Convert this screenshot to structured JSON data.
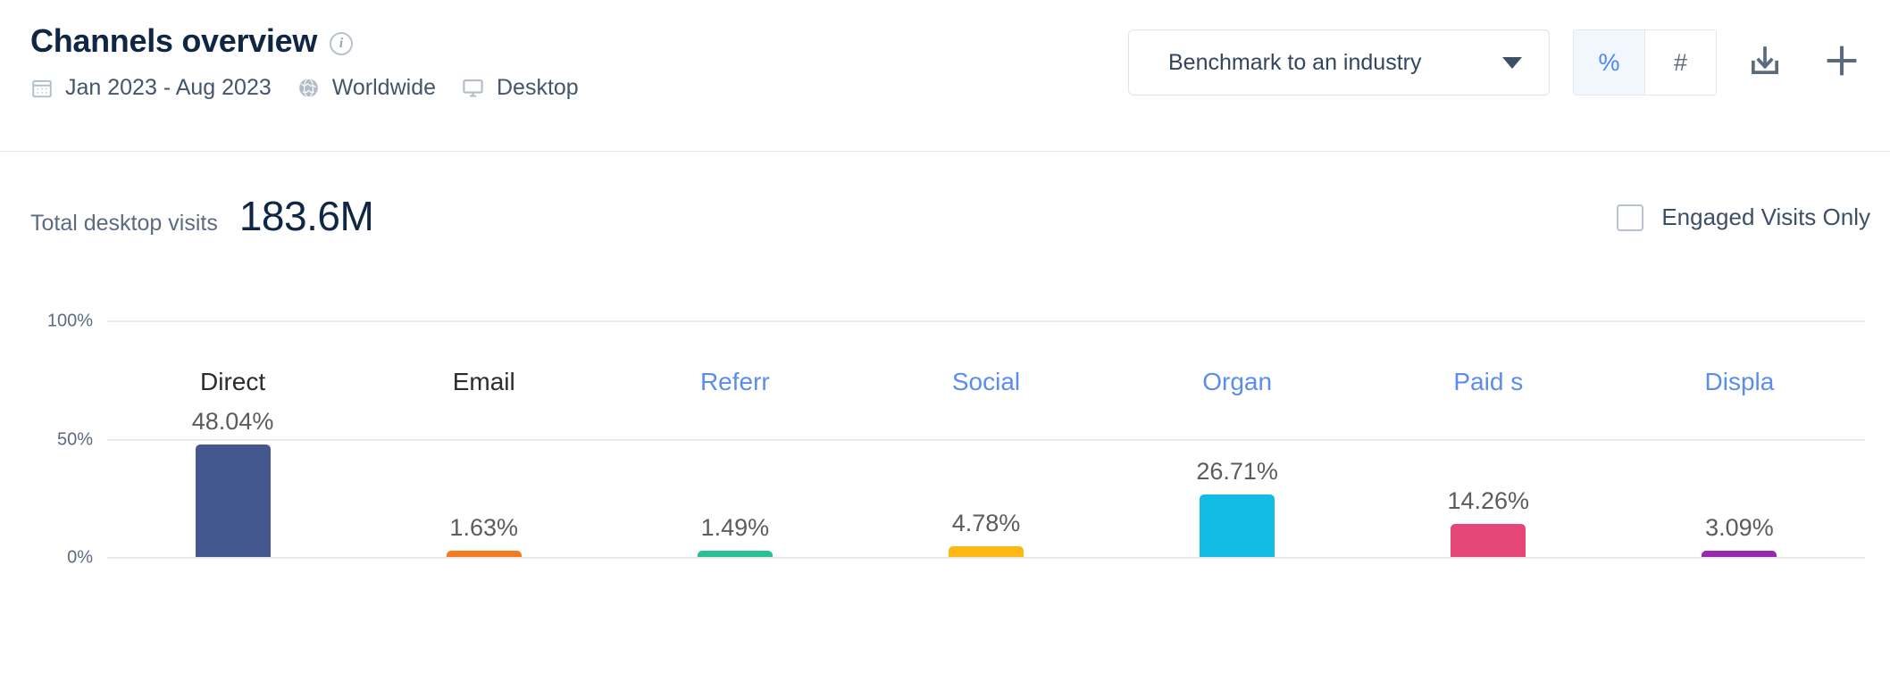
{
  "header": {
    "title": "Channels overview",
    "info_icon": "info-icon",
    "meta": {
      "calendar_icon": "calendar-icon",
      "date_range": "Jan 2023 - Aug 2023",
      "globe_icon": "globe-icon",
      "region": "Worldwide",
      "device_icon": "desktop-icon",
      "device": "Desktop"
    },
    "benchmark": {
      "label": "Benchmark to an industry",
      "caret_icon": "chevron-down-icon"
    },
    "unit_toggle": {
      "percent_label": "%",
      "number_label": "#",
      "active": "%"
    },
    "download_icon": "download-icon",
    "add_icon": "plus-icon"
  },
  "summary": {
    "label": "Total desktop visits",
    "value": "183.6M",
    "engaged_checkbox_label": "Engaged Visits Only",
    "engaged_checked": false
  },
  "chart_data": {
    "type": "bar",
    "title": "Channels overview",
    "xlabel": "",
    "ylabel": "",
    "ylim": [
      0,
      100
    ],
    "yticks": [
      0,
      50,
      100
    ],
    "ytick_labels": [
      "0%",
      "50%",
      "100%"
    ],
    "grid": true,
    "legend": "none",
    "unit": "%",
    "categories": [
      "Direct",
      "Email",
      "Referr",
      "Social",
      "Organ",
      "Paid s",
      "Displa"
    ],
    "values": [
      48.04,
      1.63,
      1.49,
      4.78,
      26.71,
      14.26,
      3.09
    ],
    "value_labels": [
      "48.04%",
      "1.63%",
      "1.49%",
      "4.78%",
      "26.71%",
      "14.26%",
      "3.09%"
    ],
    "colors": [
      "#45578f",
      "#f47b20",
      "#2bbf95",
      "#fcb813",
      "#12bce4",
      "#e44677",
      "#9a27b0"
    ],
    "category_is_link": [
      false,
      false,
      true,
      true,
      true,
      true,
      true
    ]
  },
  "colors": {
    "accent": "#4a86f7",
    "title": "#0f2644",
    "muted": "#5b6b80",
    "grid": "#e8eaee"
  }
}
